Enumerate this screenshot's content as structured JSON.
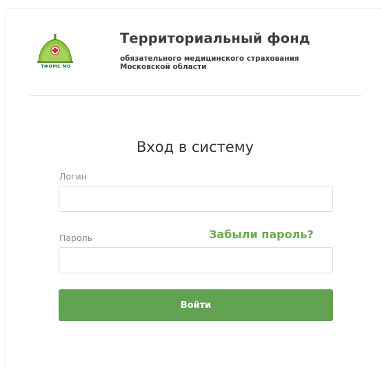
{
  "header": {
    "logo_caption": "ТФОМС МО",
    "title": "Территориальный фонд",
    "subtitle_line1": "обязательного медицинского страхования",
    "subtitle_line2": "Московской области"
  },
  "login_form": {
    "title": "Вход в систему",
    "login_label": "Логин",
    "login_value": "",
    "password_label": "Пароль",
    "password_value": "",
    "forgot_link": "Забыли пароль?",
    "submit_label": "Войти"
  },
  "colors": {
    "accent_green": "#62a253",
    "link_green": "#6aa84f",
    "logo_cross_red": "#d0262d"
  }
}
